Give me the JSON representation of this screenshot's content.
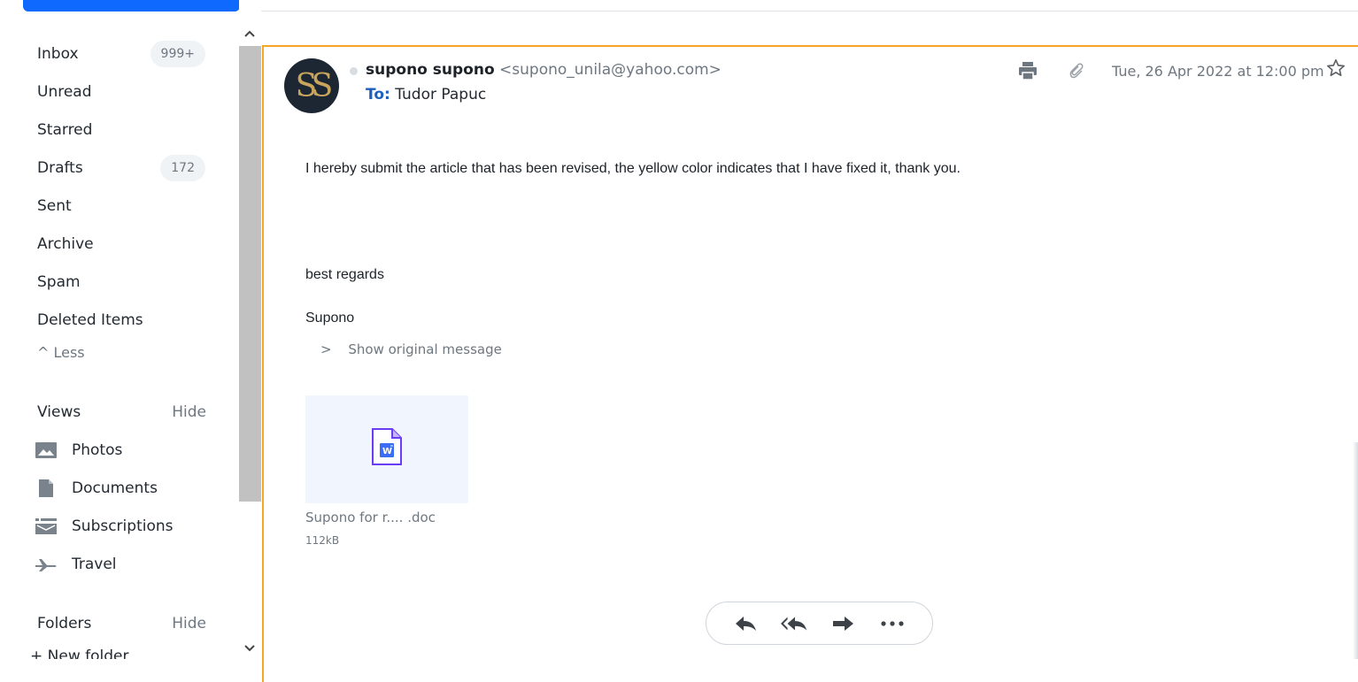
{
  "sidebar": {
    "folders": [
      {
        "label": "Inbox",
        "badge": "999+"
      },
      {
        "label": "Unread",
        "badge": ""
      },
      {
        "label": "Starred",
        "badge": ""
      },
      {
        "label": "Drafts",
        "badge": "172"
      },
      {
        "label": "Sent",
        "badge": ""
      },
      {
        "label": "Archive",
        "badge": ""
      },
      {
        "label": "Spam",
        "badge": ""
      },
      {
        "label": "Deleted Items",
        "badge": ""
      }
    ],
    "less_label": "^ Less",
    "views": {
      "title": "Views",
      "hide_label": "Hide",
      "items": [
        {
          "label": "Photos",
          "icon": "photos-icon"
        },
        {
          "label": "Documents",
          "icon": "documents-icon"
        },
        {
          "label": "Subscriptions",
          "icon": "subscriptions-icon"
        },
        {
          "label": "Travel",
          "icon": "travel-icon"
        }
      ]
    },
    "folders_section": {
      "title": "Folders",
      "hide_label": "Hide",
      "new_folder_label": "+ New folder"
    }
  },
  "message": {
    "sender_name": "supono supono",
    "sender_email": "<supono_unila@yahoo.com>",
    "to_label": "To:",
    "to_name": "Tudor Papuc",
    "date": "Tue, 26 Apr 2022 at 12:00 pm",
    "avatar_initials": "SS",
    "body_line1": "I hereby submit the article that has been revised, the yellow color indicates that I have fixed it, thank you.",
    "body_line2": "best regards",
    "body_line3": "Supono",
    "show_original": "Show original message",
    "attachment": {
      "name": "Supono for r.... .doc",
      "size": "112kB",
      "icon": "word-doc-icon"
    }
  },
  "colors": {
    "accent": "#0f69ff",
    "selected_border": "#f5a623",
    "word_purple": "#6b3cf5"
  }
}
